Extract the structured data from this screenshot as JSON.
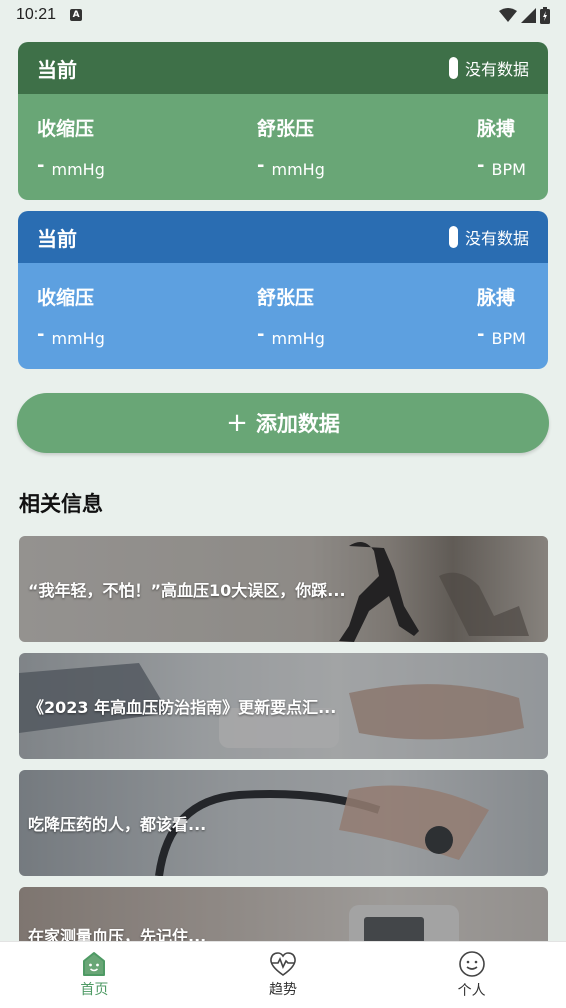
{
  "status_bar": {
    "time": "10:21",
    "notification_letter": "A"
  },
  "cards": [
    {
      "header_title": "当前",
      "status_text": "没有数据",
      "metrics": [
        {
          "label": "收缩压",
          "value": "-",
          "unit": "mmHg"
        },
        {
          "label": "舒张压",
          "value": "-",
          "unit": "mmHg"
        },
        {
          "label": "脉搏",
          "value": "-",
          "unit": "BPM"
        }
      ],
      "colors": {
        "header": "#3e7048",
        "body": "#69a676"
      }
    },
    {
      "header_title": "当前",
      "status_text": "没有数据",
      "metrics": [
        {
          "label": "收缩压",
          "value": "-",
          "unit": "mmHg"
        },
        {
          "label": "舒张压",
          "value": "-",
          "unit": "mmHg"
        },
        {
          "label": "脉搏",
          "value": "-",
          "unit": "BPM"
        }
      ],
      "colors": {
        "header": "#2a6db2",
        "body": "#5da0e0"
      }
    }
  ],
  "add_button": {
    "icon": "plus-icon",
    "label": "添加数据"
  },
  "related": {
    "title": "相关信息",
    "articles": [
      {
        "title": "“我年轻，不怕！”高血压10大误区，你踩..."
      },
      {
        "title": "《2023 年高血压防治指南》更新要点汇..."
      },
      {
        "title": "吃降压药的人，都该看..."
      },
      {
        "title": "在家测量血压，先记住..."
      }
    ]
  },
  "bottom_nav": {
    "items": [
      {
        "label": "首页",
        "icon": "home-icon",
        "active": true
      },
      {
        "label": "趋势",
        "icon": "heart-pulse-icon",
        "active": false
      },
      {
        "label": "个人",
        "icon": "smile-face-icon",
        "active": false
      }
    ],
    "active_color": "#4e9a64"
  }
}
